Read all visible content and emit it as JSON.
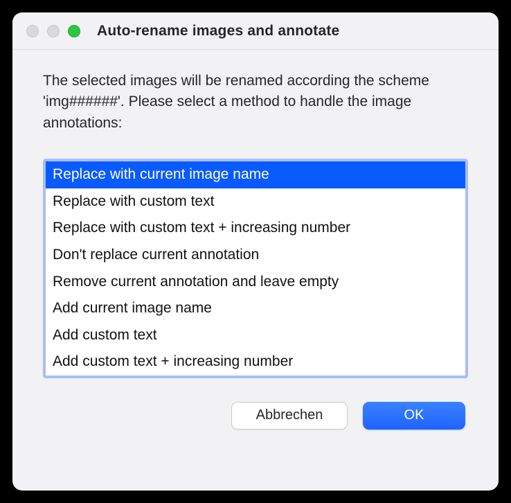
{
  "window": {
    "title": "Auto-rename images and annotate"
  },
  "message": "The selected images will be renamed according the scheme 'img######'. Please select a method to handle the image annotations:",
  "options": [
    "Replace with current image name",
    "Replace with custom text",
    "Replace with custom text + increasing number",
    "Don't replace current annotation",
    "Remove current annotation and leave empty",
    "Add current image name",
    "Add custom text",
    "Add custom text + increasing number"
  ],
  "selectedIndex": 0,
  "buttons": {
    "cancel": "Abbrechen",
    "ok": "OK"
  }
}
